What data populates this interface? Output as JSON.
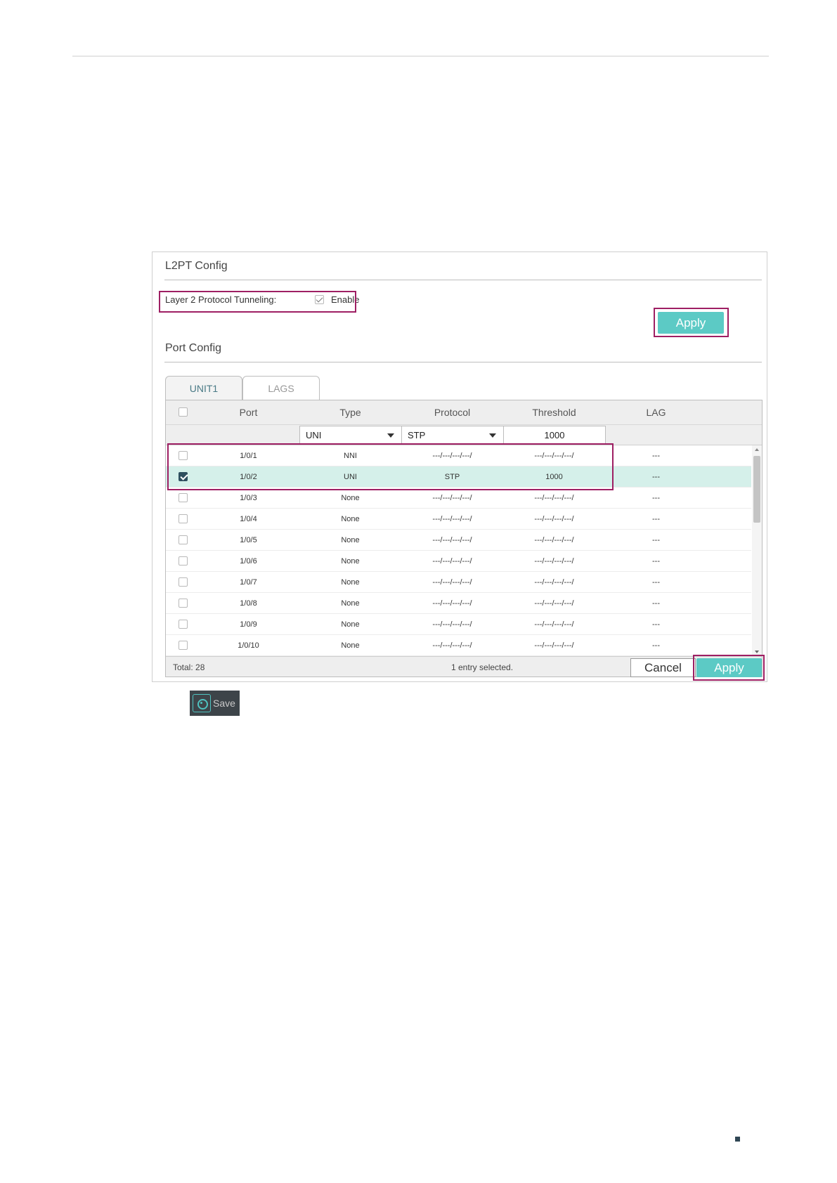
{
  "l2pt_config": {
    "title": "L2PT Config",
    "tunneling_label": "Layer 2 Protocol Tunneling:",
    "enable_label": "Enable",
    "enable_checked": true,
    "apply_label": "Apply"
  },
  "port_config": {
    "title": "Port Config",
    "tabs": [
      {
        "label": "UNIT1",
        "active": true
      },
      {
        "label": "LAGS",
        "active": false
      }
    ],
    "columns": [
      "Port",
      "Type",
      "Protocol",
      "Threshold",
      "LAG"
    ],
    "filter": {
      "type_value": "UNI",
      "protocol_value": "STP",
      "threshold_value": "1000"
    },
    "rows": [
      {
        "port": "1/0/1",
        "type": "NNI",
        "protocol": "---/---/---/---/",
        "threshold": "---/---/---/---/",
        "lag": "---",
        "checked": false
      },
      {
        "port": "1/0/2",
        "type": "UNI",
        "protocol": "STP",
        "threshold": "1000",
        "lag": "---",
        "checked": true
      },
      {
        "port": "1/0/3",
        "type": "None",
        "protocol": "---/---/---/---/",
        "threshold": "---/---/---/---/",
        "lag": "---",
        "checked": false
      },
      {
        "port": "1/0/4",
        "type": "None",
        "protocol": "---/---/---/---/",
        "threshold": "---/---/---/---/",
        "lag": "---",
        "checked": false
      },
      {
        "port": "1/0/5",
        "type": "None",
        "protocol": "---/---/---/---/",
        "threshold": "---/---/---/---/",
        "lag": "---",
        "checked": false
      },
      {
        "port": "1/0/6",
        "type": "None",
        "protocol": "---/---/---/---/",
        "threshold": "---/---/---/---/",
        "lag": "---",
        "checked": false
      },
      {
        "port": "1/0/7",
        "type": "None",
        "protocol": "---/---/---/---/",
        "threshold": "---/---/---/---/",
        "lag": "---",
        "checked": false
      },
      {
        "port": "1/0/8",
        "type": "None",
        "protocol": "---/---/---/---/",
        "threshold": "---/---/---/---/",
        "lag": "---",
        "checked": false
      },
      {
        "port": "1/0/9",
        "type": "None",
        "protocol": "---/---/---/---/",
        "threshold": "---/---/---/---/",
        "lag": "---",
        "checked": false
      },
      {
        "port": "1/0/10",
        "type": "None",
        "protocol": "---/---/---/---/",
        "threshold": "---/---/---/---/",
        "lag": "---",
        "checked": false
      }
    ],
    "footer": {
      "total": "Total: 28",
      "selection": "1 entry selected.",
      "cancel_label": "Cancel",
      "apply_label": "Apply"
    }
  },
  "save_button": {
    "label": "Save",
    "icon": "save-gear-icon"
  },
  "colors": {
    "accent": "#5ccac5",
    "highlight_box": "#9e1f63",
    "selected_row": "#d5f0ea",
    "save_bg": "#3d4449"
  }
}
